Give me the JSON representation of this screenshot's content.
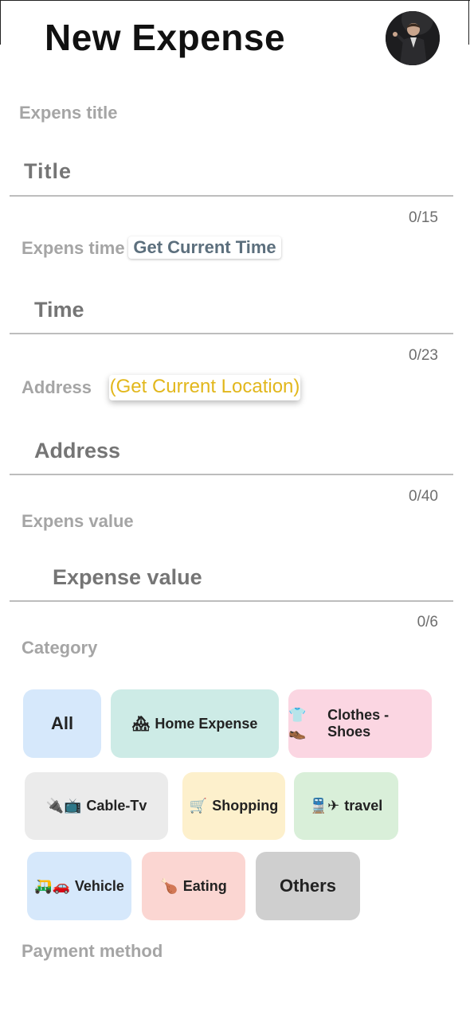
{
  "header": {
    "title": "New Expense",
    "avatar_icon": "user-avatar"
  },
  "fields": {
    "title": {
      "label": "Expens title",
      "placeholder": "Title",
      "counter": "0/15"
    },
    "time": {
      "label": "Expens time",
      "action": "Get Current Time",
      "placeholder": "Time",
      "counter": "0/23"
    },
    "address": {
      "label": "Address",
      "action": "(Get Current Location)",
      "placeholder": "Address",
      "counter": "0/40"
    },
    "value": {
      "label": "Expens value",
      "placeholder": "Expense value",
      "counter": "0/6"
    }
  },
  "category": {
    "label": "Category",
    "chips": [
      {
        "label": "All",
        "icon": "",
        "color": "#d6e8fb"
      },
      {
        "label": "Home Expense",
        "icon": "🏘",
        "color": "#cdebe6"
      },
      {
        "label": "Clothes - Shoes",
        "icon": "👕👞",
        "color": "#fbd6e2"
      },
      {
        "label": "Cable-Tv",
        "icon": "🔌📺",
        "color": "#ebebeb"
      },
      {
        "label": "Shopping",
        "icon": "🛒",
        "color": "#fdf0cc"
      },
      {
        "label": "travel",
        "icon": "🚆✈",
        "color": "#d9efd9"
      },
      {
        "label": "Vehicle",
        "icon": "🛺🚗",
        "color": "#d6e8fb"
      },
      {
        "label": "Eating",
        "icon": "🍗",
        "color": "#fbd6d2"
      },
      {
        "label": "Others",
        "icon": "",
        "color": "#cfcfcf"
      }
    ]
  },
  "payment": {
    "label": "Payment method"
  }
}
